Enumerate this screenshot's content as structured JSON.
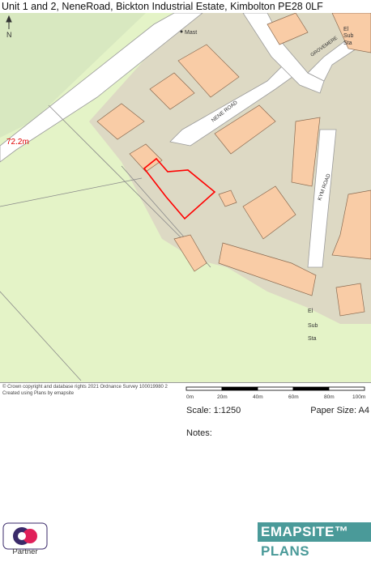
{
  "title": "Unit 1 and 2, NeneRoad, Bickton Industrial Estate, Kimbolton PE28 0LF",
  "map": {
    "north_label": "N",
    "spot_height": "72.2m",
    "labels": {
      "nene_road": "NENE ROAD",
      "kym_road": "KYM ROAD",
      "grovemere": "GROVEMERE",
      "mast": "Mast",
      "el_sub_sta_1a": "El",
      "el_sub_sta_1b": "Sub",
      "el_sub_sta_1c": "Sta",
      "el_sub_sta_2a": "El",
      "el_sub_sta_2b": "Sub",
      "el_sub_sta_2c": "Sta"
    },
    "colors": {
      "field": "#e4f3c7",
      "industrial": "#ddd9c4",
      "building": "#f9cca6",
      "road": "#ffffff",
      "boundary": "#ff0000",
      "spot_height": "#e00000"
    }
  },
  "copyright": "© Crown copyright and database rights 2021 Ordnance Survey 100019980 2 Created using Plans by emapsite",
  "scale": {
    "label": "Scale: 1:1250",
    "ticks": [
      "0m",
      "20m",
      "40m",
      "60m",
      "80m",
      "100m"
    ]
  },
  "paper_size": "Paper Size: A4",
  "notes_label": "Notes:",
  "logos": {
    "os_partner": "Partner",
    "emapsite_top": "EMAPSITE™",
    "emapsite_bottom": "PLANS"
  }
}
